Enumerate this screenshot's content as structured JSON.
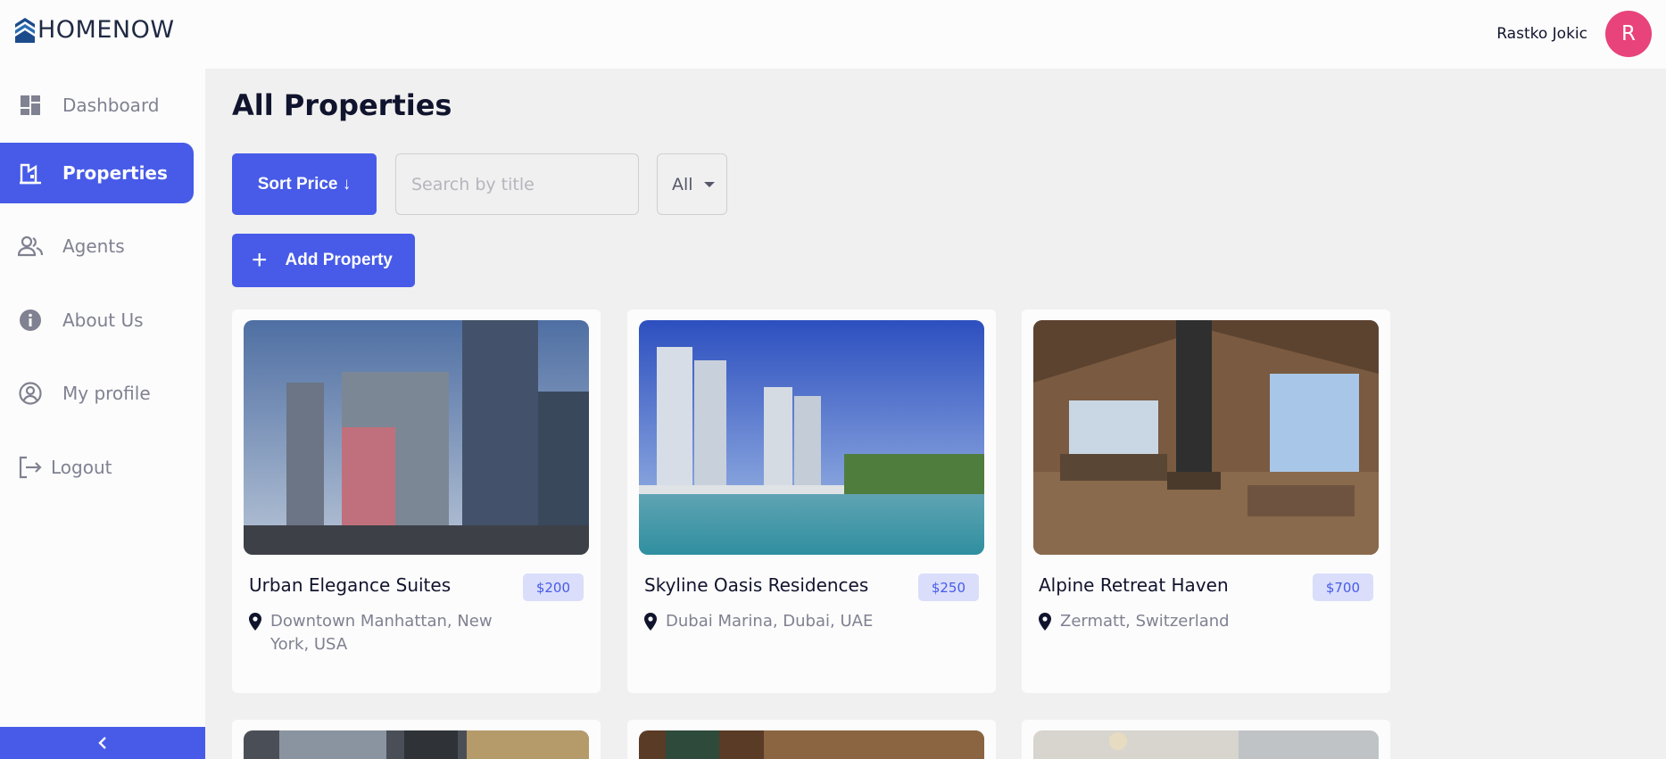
{
  "app": {
    "logo_text": "HOMENOW"
  },
  "user": {
    "name": "Rastko Jokic",
    "initial": "R"
  },
  "sidebar": {
    "items": [
      {
        "label": "Dashboard",
        "icon": "dashboard-icon"
      },
      {
        "label": "Properties",
        "icon": "properties-icon",
        "active": true
      },
      {
        "label": "Agents",
        "icon": "agents-icon"
      },
      {
        "label": "About Us",
        "icon": "info-icon"
      },
      {
        "label": "My profile",
        "icon": "profile-icon"
      },
      {
        "label": "Logout",
        "icon": "logout-icon"
      }
    ],
    "collapse_icon": "chevron-left-icon"
  },
  "main": {
    "title": "All Properties",
    "sort_label": "Sort Price ↓",
    "search_placeholder": "Search by title",
    "filter_value": "All",
    "add_label": "Add Property"
  },
  "properties": [
    {
      "name": "Urban Elegance Suites",
      "price": "$200",
      "location": "Downtown Manhattan, New York, USA"
    },
    {
      "name": "Skyline Oasis Residences",
      "price": "$250",
      "location": "Dubai Marina, Dubai, UAE"
    },
    {
      "name": "Alpine Retreat Haven",
      "price": "$700",
      "location": "Zermatt, Switzerland"
    }
  ],
  "colors": {
    "accent": "#475be8",
    "avatar": "#e8437a",
    "price_bg": "#dadefa"
  }
}
